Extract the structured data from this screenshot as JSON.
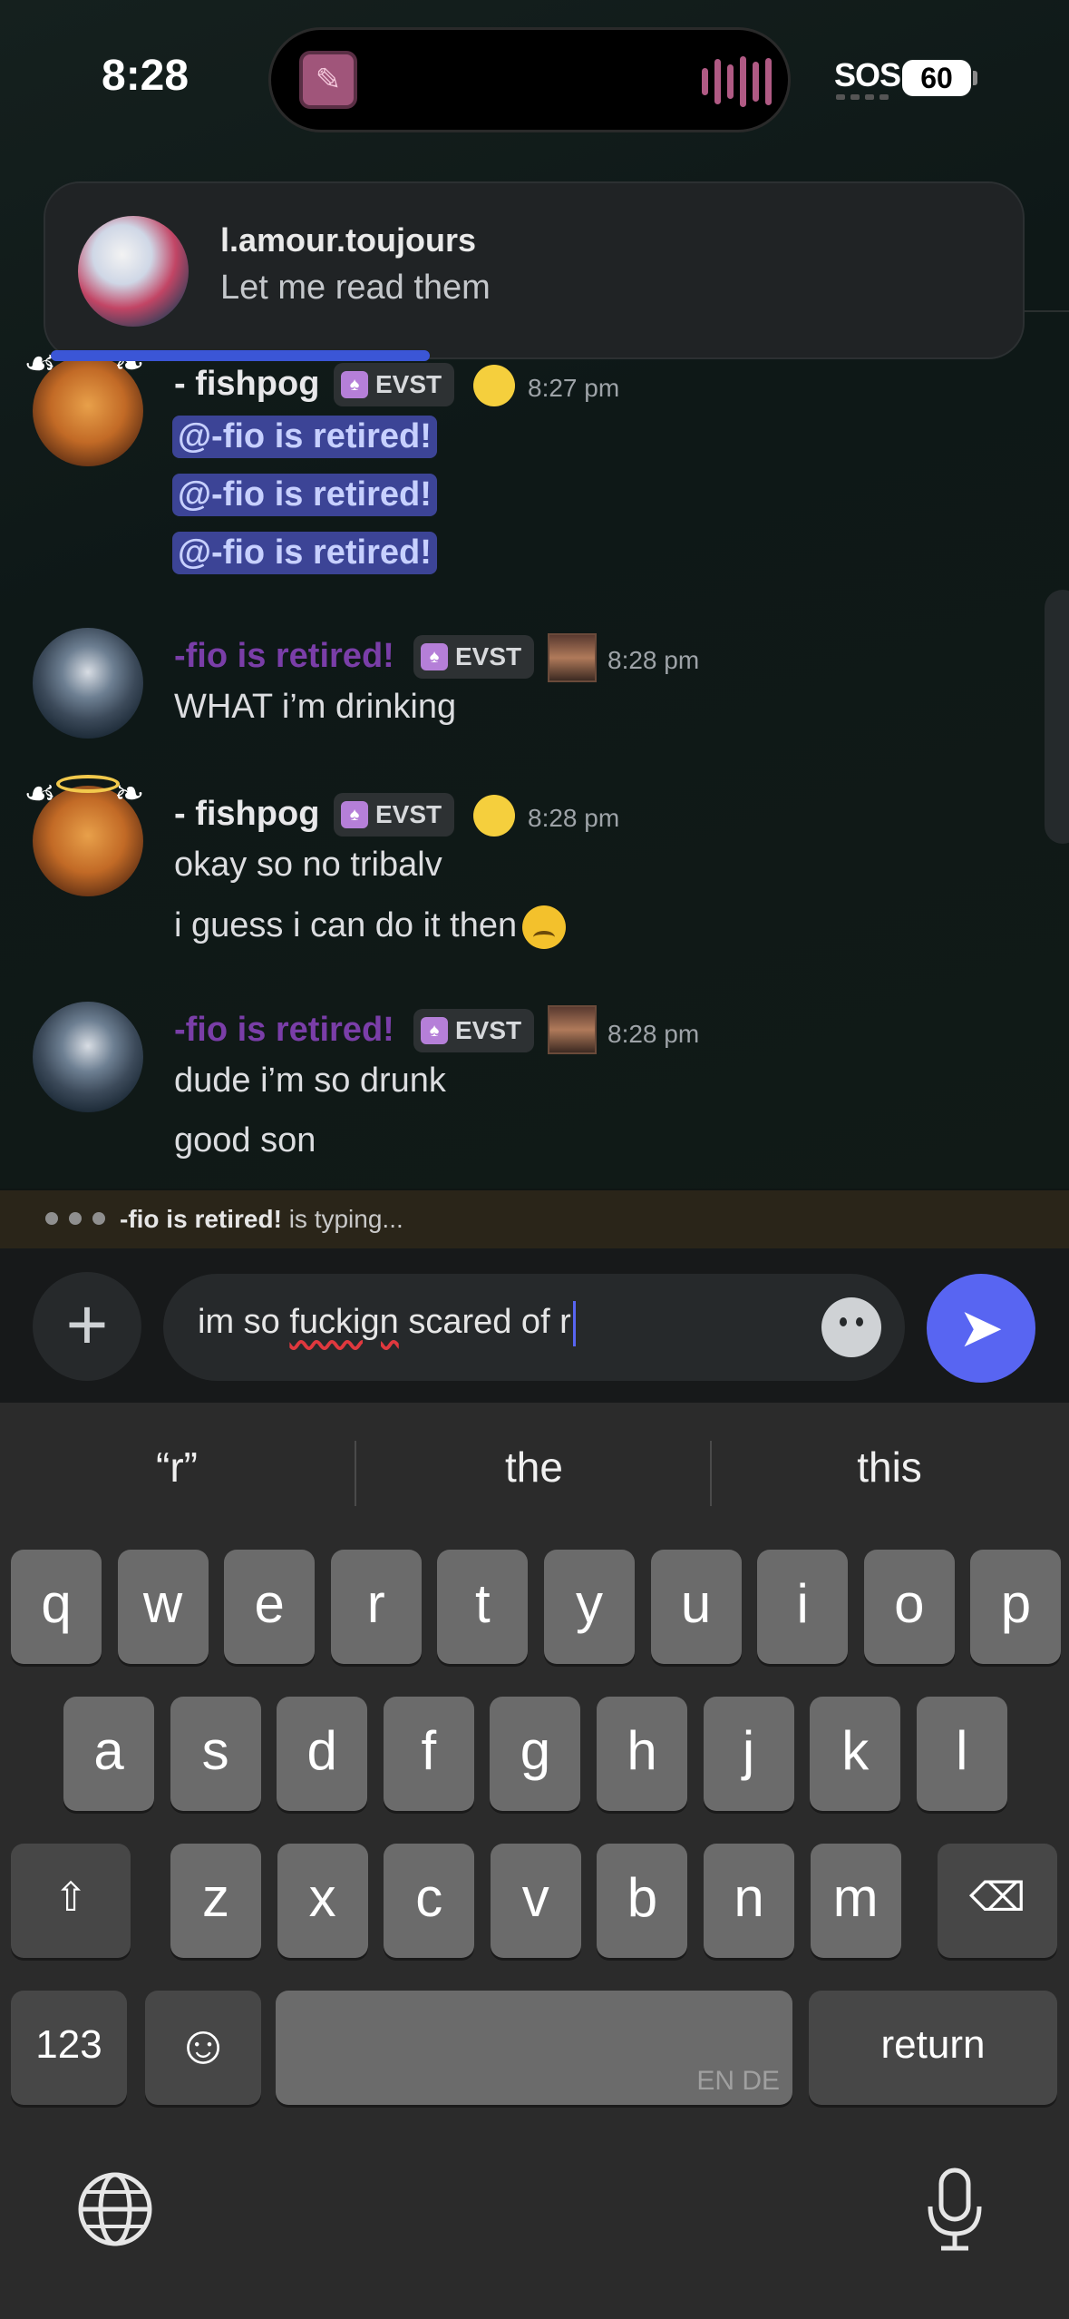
{
  "status_bar": {
    "time": "8:28",
    "sos": "SOS",
    "battery": "60"
  },
  "notification": {
    "sender": "l.amour.toujours",
    "message": "Let me read them"
  },
  "messages": [
    {
      "author": "- fishpog",
      "tag": "EVST",
      "time": "8:27 pm",
      "mentions": [
        "@-fio is retired!",
        "@-fio is retired!",
        "@-fio is retired!"
      ]
    },
    {
      "author": "-fio is retired!",
      "tag": "EVST",
      "time": "8:28 pm",
      "lines": [
        "WHAT i’m drinking"
      ]
    },
    {
      "author": "- fishpog",
      "tag": "EVST",
      "time": "8:28 pm",
      "lines": [
        "okay so no tribalv",
        "i guess i can do it then"
      ]
    },
    {
      "author": "-fio is retired!",
      "tag": "EVST",
      "time": "8:28 pm",
      "lines": [
        "dude i’m so drunk",
        "good son"
      ]
    }
  ],
  "typing": {
    "user": "-fio is retired!",
    "suffix": " is typing..."
  },
  "composer": {
    "text_before": "im so ",
    "misspelled": "fuckign",
    "text_after": " scared of r"
  },
  "keyboard": {
    "suggestions": [
      "“r”",
      "the",
      "this"
    ],
    "row1": [
      "q",
      "w",
      "e",
      "r",
      "t",
      "y",
      "u",
      "i",
      "o",
      "p"
    ],
    "row2": [
      "a",
      "s",
      "d",
      "f",
      "g",
      "h",
      "j",
      "k",
      "l"
    ],
    "row3": [
      "z",
      "x",
      "c",
      "v",
      "b",
      "n",
      "m"
    ],
    "numbers_label": "123",
    "space_languages": "EN DE",
    "return_label": "return"
  },
  "colors": {
    "accent": "#5865f2",
    "mention_bg": "#3c4496",
    "fio_name": "#7a3ea8"
  }
}
